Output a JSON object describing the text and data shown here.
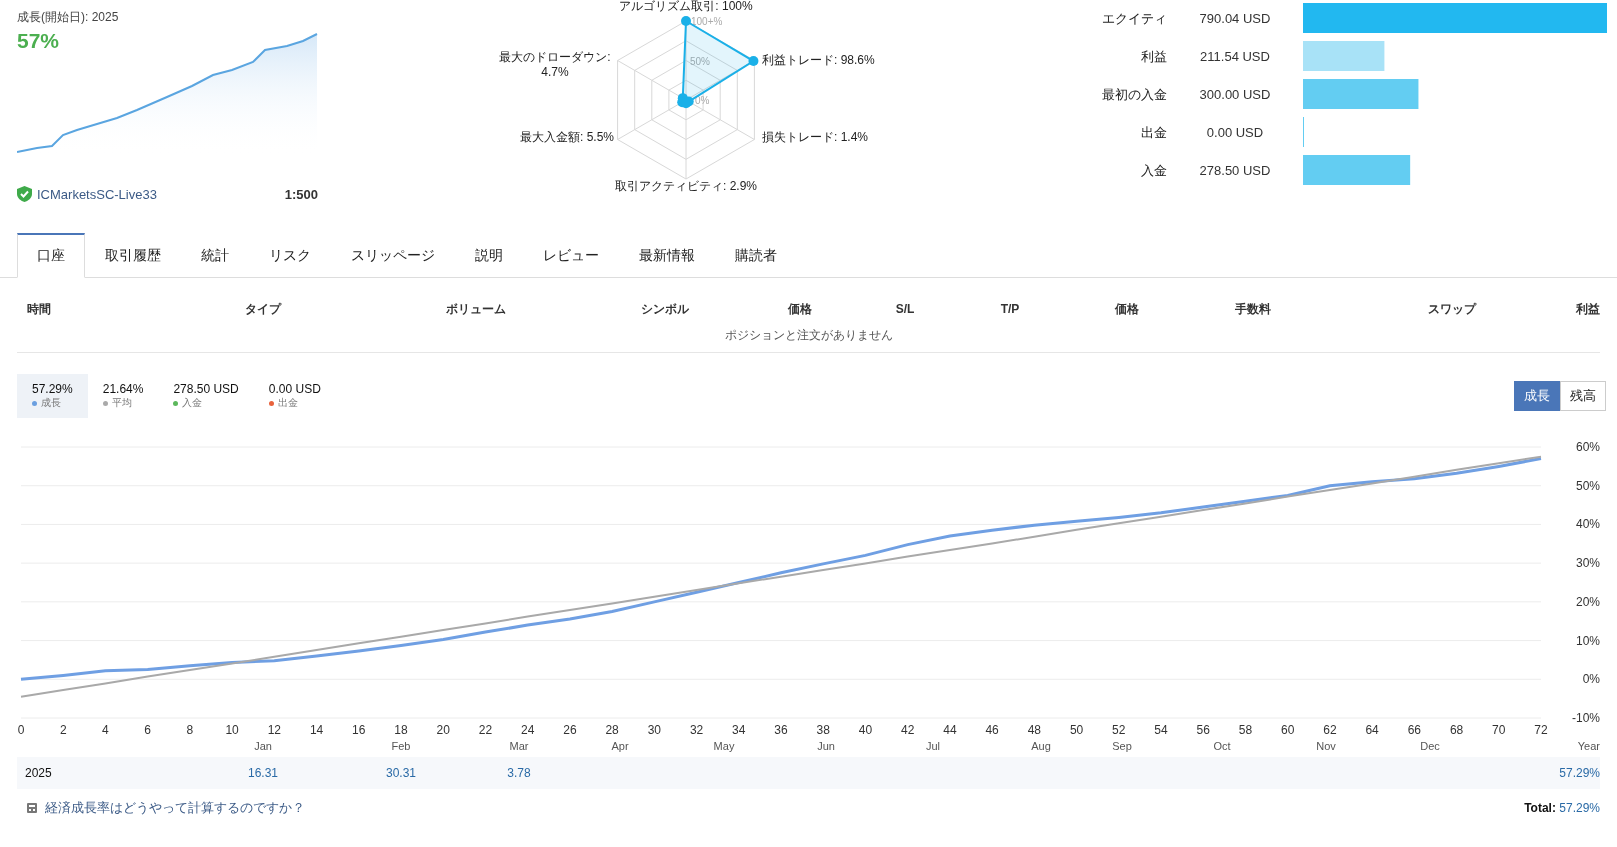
{
  "growth_summary": {
    "title": "成長(開始日): 2025",
    "value": "57%",
    "broker": "ICMarketsSC-Live33",
    "leverage": "1:500"
  },
  "radar": {
    "ticks": [
      "100+%",
      "50%",
      "0%"
    ],
    "axes": [
      {
        "label": "アルゴリズム取引: 100%",
        "level": 1
      },
      {
        "label": "最大のドローダウン: 4.7%",
        "level": 0.047
      },
      {
        "label": "利益トレード: 98.6%",
        "level": 0.986
      },
      {
        "label": "最大入金額: 5.5%",
        "level": 0.055
      },
      {
        "label": "損失トレード: 1.4%",
        "level": 0.014
      },
      {
        "label": "取引アクティビティ: 2.9%",
        "level": 0.029
      }
    ]
  },
  "balance_chart": {
    "chart_data": {
      "type": "bar",
      "orientation": "horizontal",
      "categories": [
        "エクイティ",
        "利益",
        "最初の入金",
        "出金",
        "入金"
      ],
      "values": [
        790.04,
        211.54,
        300.0,
        0.0,
        278.5
      ],
      "value_labels": [
        "790.04 USD",
        "211.54 USD",
        "300.00 USD",
        "0.00 USD",
        "278.50 USD"
      ]
    },
    "bar_colors": [
      {
        "color": "#22b8f0"
      },
      {
        "color": "#a8e2f7"
      },
      {
        "color": "#63cdf2"
      },
      {
        "color": "#63cdf2"
      },
      {
        "color": "#63cdf2"
      }
    ]
  },
  "tabs": [
    {
      "label": "口座",
      "selected": true
    },
    {
      "label": "取引履歴",
      "selected": false
    },
    {
      "label": "統計",
      "selected": false
    },
    {
      "label": "リスク",
      "selected": false
    },
    {
      "label": "スリッページ",
      "selected": false
    },
    {
      "label": "説明",
      "selected": false
    },
    {
      "label": "レビュー",
      "selected": false
    },
    {
      "label": "最新情報",
      "selected": false
    },
    {
      "label": "購読者",
      "selected": false
    }
  ],
  "positions_table": {
    "columns": [
      "時間",
      "タイプ",
      "ボリューム",
      "シンボル",
      "価格",
      "S/L",
      "T/P",
      "価格",
      "手数料",
      "スワップ",
      "利益"
    ],
    "empty_message": "ポジションと注文がありません"
  },
  "legend": [
    {
      "value": "57.29%",
      "label": "成長",
      "color": "#6a9fe0",
      "selected": true
    },
    {
      "value": "21.64%",
      "label": "平均",
      "color": "#aaaaaa",
      "selected": false
    },
    {
      "value": "278.50 USD",
      "label": "入金",
      "color": "#5cb85c",
      "selected": false
    },
    {
      "value": "0.00 USD",
      "label": "出金",
      "color": "#e8623c",
      "selected": false
    }
  ],
  "view_toggle": [
    {
      "label": "成長",
      "selected": true
    },
    {
      "label": "残高",
      "selected": false
    }
  ],
  "chart": {
    "chart_data": {
      "type": "line",
      "x": [
        0,
        2,
        4,
        6,
        8,
        10,
        12,
        14,
        16,
        18,
        20,
        22,
        24,
        26,
        28,
        30,
        32,
        34,
        36,
        38,
        40,
        42,
        44,
        46,
        48,
        50,
        52,
        54,
        56,
        58,
        60,
        62,
        64,
        66,
        68,
        70,
        72
      ],
      "series": [
        {
          "color": "#6f9fe3",
          "values": [
            0,
            1,
            2.2,
            2.5,
            3.5,
            4.3,
            4.8,
            6,
            7.3,
            8.7,
            10.3,
            12.2,
            14,
            15.6,
            17.5,
            20,
            22.5,
            25,
            27.5,
            29.8,
            32,
            34.8,
            37,
            38.5,
            39.8,
            40.8,
            41.8,
            43,
            44.5,
            46,
            47.5,
            50,
            51,
            51.8,
            53.2,
            55,
            57
          ]
        },
        {
          "color": "#a9a9a9",
          "values": [
            -4.5,
            -2.8,
            -1.1,
            0.7,
            2.4,
            4.1,
            5.8,
            7.6,
            9.3,
            11,
            12.7,
            14.4,
            16.2,
            17.9,
            19.6,
            21.3,
            23.1,
            24.8,
            26.5,
            28.2,
            29.9,
            31.7,
            33.4,
            35.1,
            36.8,
            38.6,
            40.3,
            42,
            43.7,
            45.4,
            47.2,
            48.9,
            50.6,
            52.3,
            54.1,
            55.8,
            57.5
          ]
        }
      ],
      "xlim": [
        0,
        72
      ],
      "ylim": [
        -10,
        60
      ],
      "grid": true,
      "xticks": [
        0,
        2,
        4,
        6,
        8,
        10,
        12,
        14,
        16,
        18,
        20,
        22,
        24,
        26,
        28,
        30,
        32,
        34,
        36,
        38,
        40,
        42,
        44,
        46,
        48,
        50,
        52,
        54,
        56,
        58,
        60,
        62,
        64,
        66,
        68,
        70,
        72
      ],
      "yticks": [
        {
          "value": -10,
          "label": "-10%"
        },
        {
          "value": 0,
          "label": "0%"
        },
        {
          "value": 10,
          "label": "10%"
        },
        {
          "value": 20,
          "label": "20%"
        },
        {
          "value": 30,
          "label": "30%"
        },
        {
          "value": 40,
          "label": "40%"
        },
        {
          "value": 50,
          "label": "50%"
        },
        {
          "value": 60,
          "label": "60%"
        }
      ]
    }
  },
  "months": [
    "Jan",
    "Feb",
    "Mar",
    "Apr",
    "May",
    "Jun",
    "Jul",
    "Aug",
    "Sep",
    "Oct",
    "Nov",
    "Dec",
    "Year"
  ],
  "year_row": {
    "year": "2025",
    "values": [
      "16.31",
      "30.31",
      "3.78"
    ],
    "year_total": "57.29%"
  },
  "footer": {
    "link": "経済成長率はどうやって計算するのですか？",
    "total_label": "Total:",
    "total_value": "57.29%"
  }
}
